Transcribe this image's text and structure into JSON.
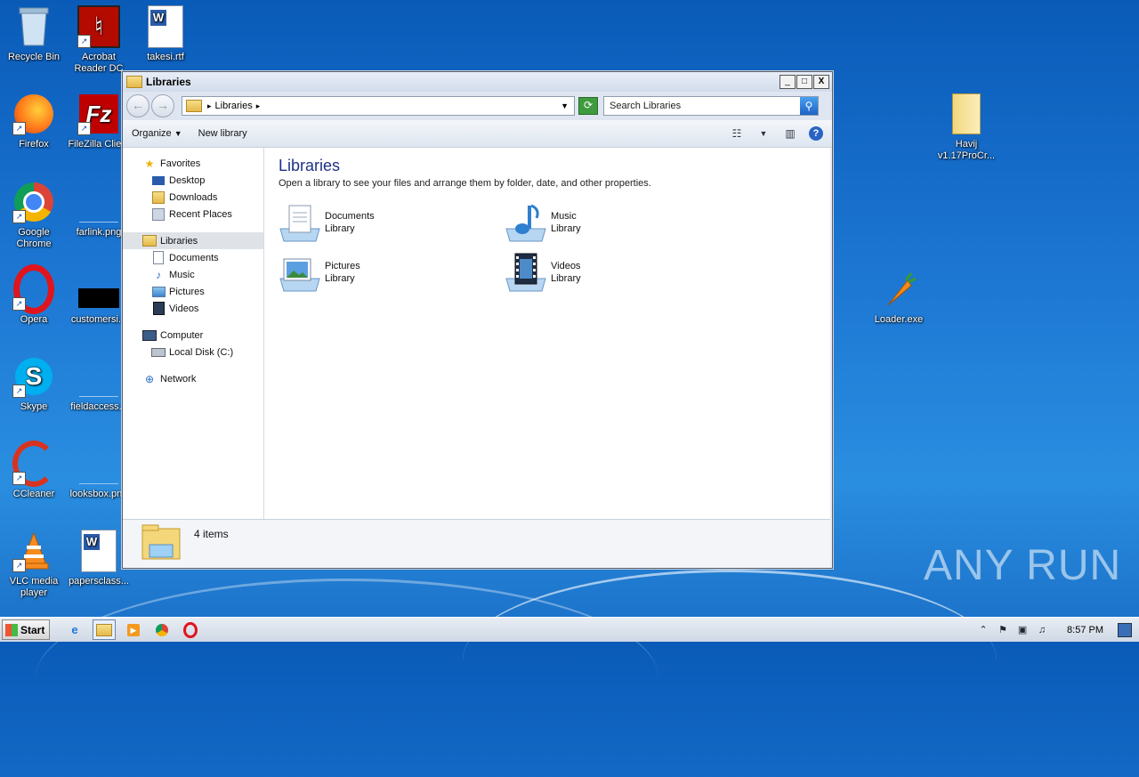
{
  "desktop": {
    "icons": [
      {
        "label": "Recycle Bin"
      },
      {
        "label": "Acrobat Reader DC"
      },
      {
        "label": "takesi.rtf"
      },
      {
        "label": "Firefox"
      },
      {
        "label": "FileZilla Client"
      },
      {
        "label": "Google Chrome"
      },
      {
        "label": "farlink.png"
      },
      {
        "label": "Opera"
      },
      {
        "label": "customersi..."
      },
      {
        "label": "Skype"
      },
      {
        "label": "fieldaccess..."
      },
      {
        "label": "CCleaner"
      },
      {
        "label": "looksbox.png"
      },
      {
        "label": "VLC media player"
      },
      {
        "label": "papersclass..."
      },
      {
        "label": "Havij v1.17ProCr..."
      },
      {
        "label": "Loader.exe"
      }
    ],
    "watermark": "ANY RUN"
  },
  "window": {
    "title": "Libraries",
    "controls": {
      "minimize": "_",
      "maximize": "□",
      "close": "X"
    },
    "address": {
      "path": "Libraries"
    },
    "search": {
      "placeholder": "Search Libraries"
    },
    "commands": {
      "organize": "Organize",
      "new_library": "New library"
    },
    "nav": {
      "favorites": "Favorites",
      "desktop": "Desktop",
      "downloads": "Downloads",
      "recent": "Recent Places",
      "libraries": "Libraries",
      "documents": "Documents",
      "music": "Music",
      "pictures": "Pictures",
      "videos": "Videos",
      "computer": "Computer",
      "local_disk": "Local Disk (C:)",
      "network": "Network"
    },
    "content": {
      "title": "Libraries",
      "subtitle": "Open a library to see your files and arrange them by folder, date, and other properties.",
      "libraries": [
        {
          "name": "Documents",
          "type": "Library"
        },
        {
          "name": "Music",
          "type": "Library"
        },
        {
          "name": "Pictures",
          "type": "Library"
        },
        {
          "name": "Videos",
          "type": "Library"
        }
      ]
    },
    "status": {
      "count": "4 items"
    }
  },
  "taskbar": {
    "start": "Start",
    "clock": "8:57 PM"
  }
}
